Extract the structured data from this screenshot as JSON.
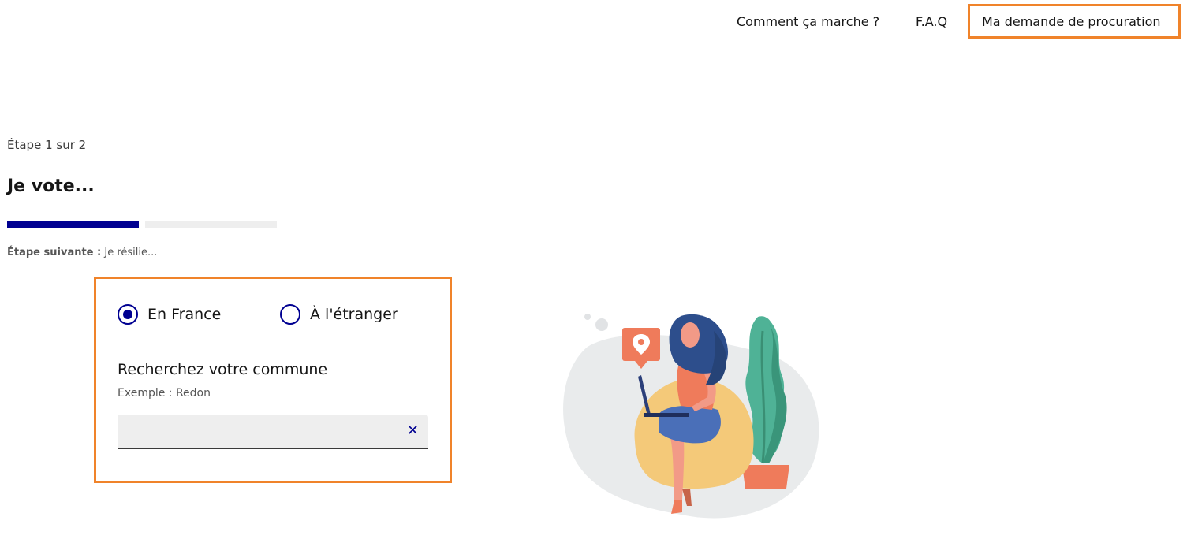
{
  "header": {
    "nav": {
      "how_it_works": "Comment ça marche ?",
      "faq": "F.A.Q",
      "my_request": "Ma demande de procuration"
    }
  },
  "stepper": {
    "counter": "Étape 1 sur 2",
    "title": "Je vote...",
    "progress": 0.5,
    "next_label": "Étape suivante :",
    "next_value": "Je résilie..."
  },
  "form": {
    "location_options": [
      {
        "label": "En France",
        "selected": true
      },
      {
        "label": "À l'étranger",
        "selected": false
      }
    ],
    "search": {
      "label": "Recherchez votre commune",
      "hint": "Exemple : Redon",
      "value": "",
      "clear_icon": "close-icon"
    }
  },
  "colors": {
    "primary": "#000091",
    "highlight": "#f0832a",
    "progress_empty": "#eeeeee"
  }
}
